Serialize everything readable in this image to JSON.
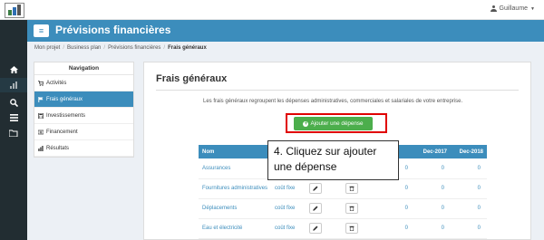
{
  "user": {
    "name": "Guillaume"
  },
  "header": {
    "menu_icon": "≡",
    "title": "Prévisions financières"
  },
  "breadcrumb": {
    "items": [
      "Mon projet",
      "Business plan",
      "Prévisions financières"
    ],
    "active": "Frais généraux"
  },
  "sidebar": {
    "icons": [
      "home-icon",
      "chart-icon",
      "search-icon",
      "list-icon",
      "folder-icon"
    ]
  },
  "nav": {
    "title": "Navigation",
    "items": [
      {
        "label": "Activités",
        "icon": "cart-icon"
      },
      {
        "label": "Frais généraux",
        "icon": "flag-icon"
      },
      {
        "label": "Investissements",
        "icon": "calculator-icon"
      },
      {
        "label": "Financement",
        "icon": "money-icon"
      },
      {
        "label": "Résultats",
        "icon": "bar-chart-icon"
      }
    ]
  },
  "main": {
    "title": "Frais généraux",
    "description": "Les frais généraux regroupent les dépenses administratives, commerciales et salariales de votre entreprise.",
    "add_button": "Ajouter une dépense"
  },
  "table": {
    "columns": [
      "Nom",
      "Dec-2017",
      "Dec-2018"
    ],
    "rows": [
      {
        "name": "Assurances",
        "type": "",
        "v1": "0",
        "v2": "0",
        "v3": "0"
      },
      {
        "name": "Fournitures administratives",
        "type": "coût fixe",
        "v1": "0",
        "v2": "0",
        "v3": "0"
      },
      {
        "name": "Déplacements",
        "type": "coût fixe",
        "v1": "0",
        "v2": "0",
        "v3": "0"
      },
      {
        "name": "Eau et électricité",
        "type": "coût fixe",
        "v1": "0",
        "v2": "0",
        "v3": "0"
      }
    ]
  },
  "callout": {
    "line1": "4. Cliquez sur ajouter",
    "line2": "une dépense"
  },
  "colors": {
    "primary": "#3c8dbc",
    "success": "#4cae4c",
    "highlight": "#e00000",
    "sidebar": "#222d32"
  }
}
